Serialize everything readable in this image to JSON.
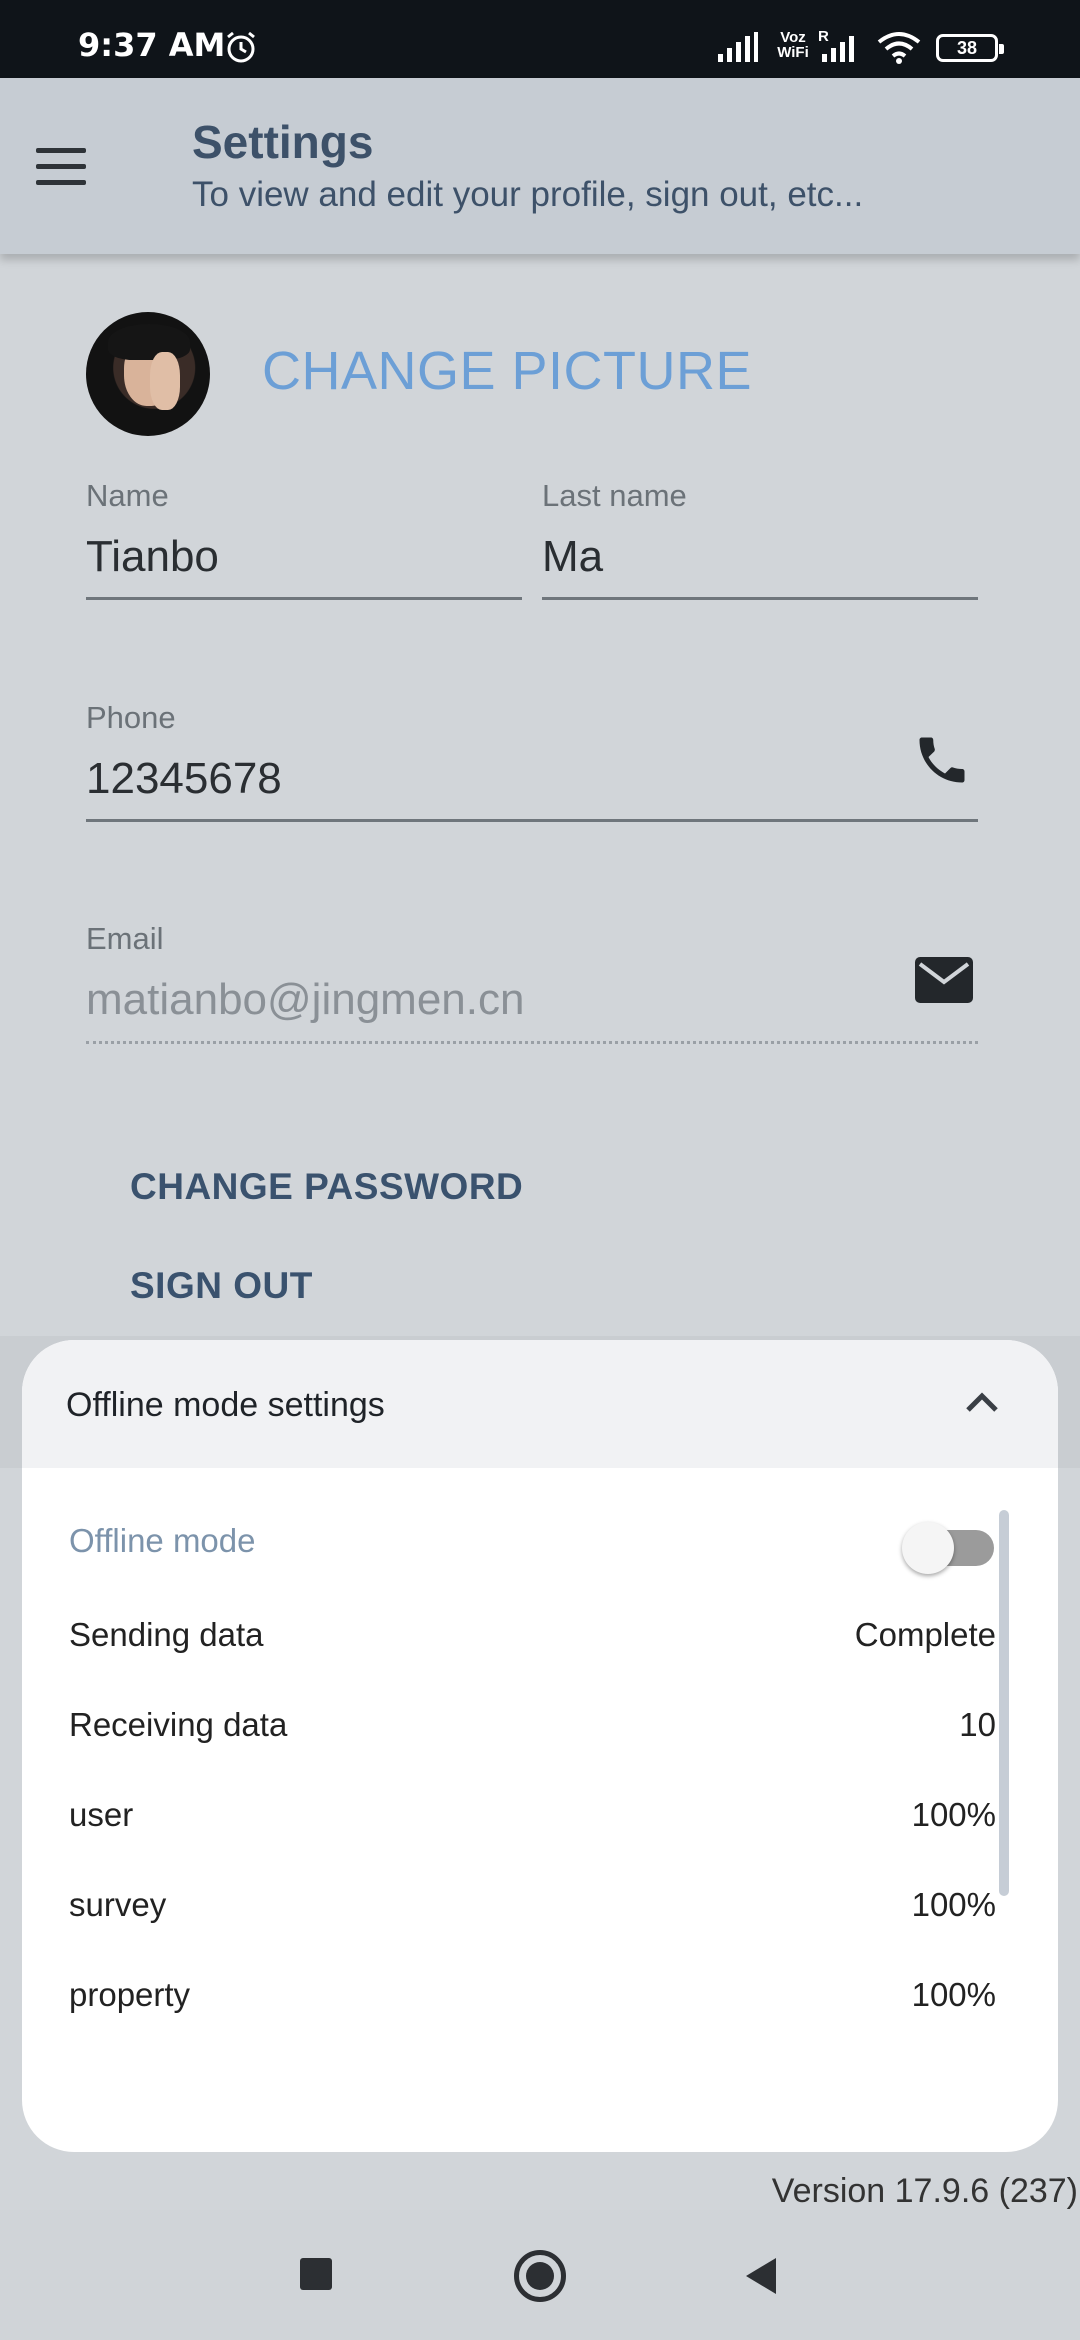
{
  "status_bar": {
    "time": "9:37 AM",
    "voz_wifi": "Voz\nWiFi",
    "roaming": "R",
    "battery": "38"
  },
  "app_bar": {
    "title": "Settings",
    "subtitle": "To view and edit your profile, sign out, etc..."
  },
  "profile": {
    "change_picture": "CHANGE PICTURE",
    "name_label": "Name",
    "name_value": "Tianbo",
    "last_name_label": "Last name",
    "last_name_value": "Ma",
    "phone_label": "Phone",
    "phone_value": "12345678",
    "email_label": "Email",
    "email_value": "matianbo@jingmen.cn"
  },
  "actions": {
    "change_password": "CHANGE PASSWORD",
    "sign_out": "SIGN OUT"
  },
  "offline_sheet": {
    "title": "Offline mode settings",
    "offline_mode_label": "Offline mode",
    "offline_mode_enabled": false,
    "rows": [
      {
        "label": "Sending data",
        "value": "Complete"
      },
      {
        "label": "Receiving data",
        "value": "10"
      },
      {
        "label": "user",
        "value": "100%"
      },
      {
        "label": "survey",
        "value": "100%"
      },
      {
        "label": "property",
        "value": "100%"
      }
    ]
  },
  "footer": {
    "version": "Version 17.9.6 (237)"
  },
  "icons": {
    "menu": "menu-icon",
    "phone": "phone-icon",
    "email": "mail-icon",
    "collapse": "chevron-up-icon",
    "alarm": "alarm-icon"
  },
  "colors": {
    "accent_link": "#6c9fd6",
    "primary_text": "#3d5169",
    "status_bar_bg": "#0f1419"
  }
}
